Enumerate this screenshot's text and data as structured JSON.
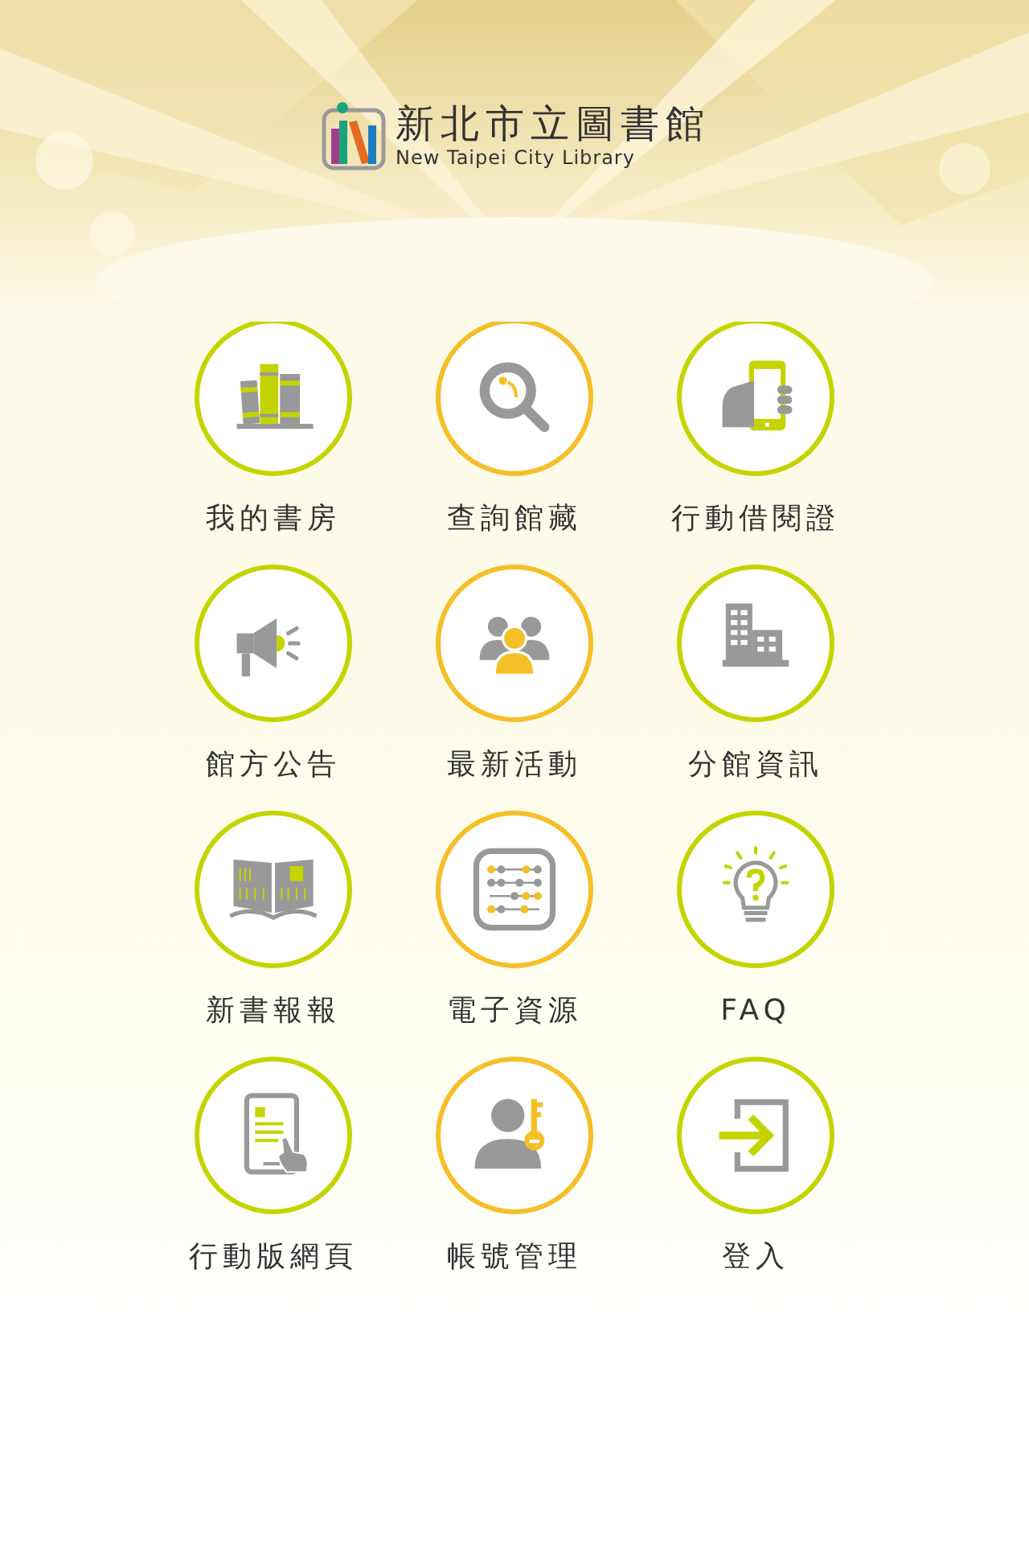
{
  "header": {
    "logo_title": "新北市立圖書館",
    "logo_subtitle": "New Taipei City Library"
  },
  "menu": [
    {
      "label": "我的書房",
      "color": "#c5d400"
    },
    {
      "label": "查詢館藏",
      "color": "#f5bf28"
    },
    {
      "label": "行動借閱證",
      "color": "#c5d400"
    },
    {
      "label": "館方公告",
      "color": "#c5d400"
    },
    {
      "label": "最新活動",
      "color": "#f5bf28"
    },
    {
      "label": "分館資訊",
      "color": "#c5d400"
    },
    {
      "label": "新書報報",
      "color": "#c5d400"
    },
    {
      "label": "電子資源",
      "color": "#f5bf28"
    },
    {
      "label": "FAQ",
      "color": "#c5d400"
    },
    {
      "label": "行動版網頁",
      "color": "#c5d400"
    },
    {
      "label": "帳號管理",
      "color": "#f5bf28"
    },
    {
      "label": "登入",
      "color": "#c5d400"
    }
  ]
}
